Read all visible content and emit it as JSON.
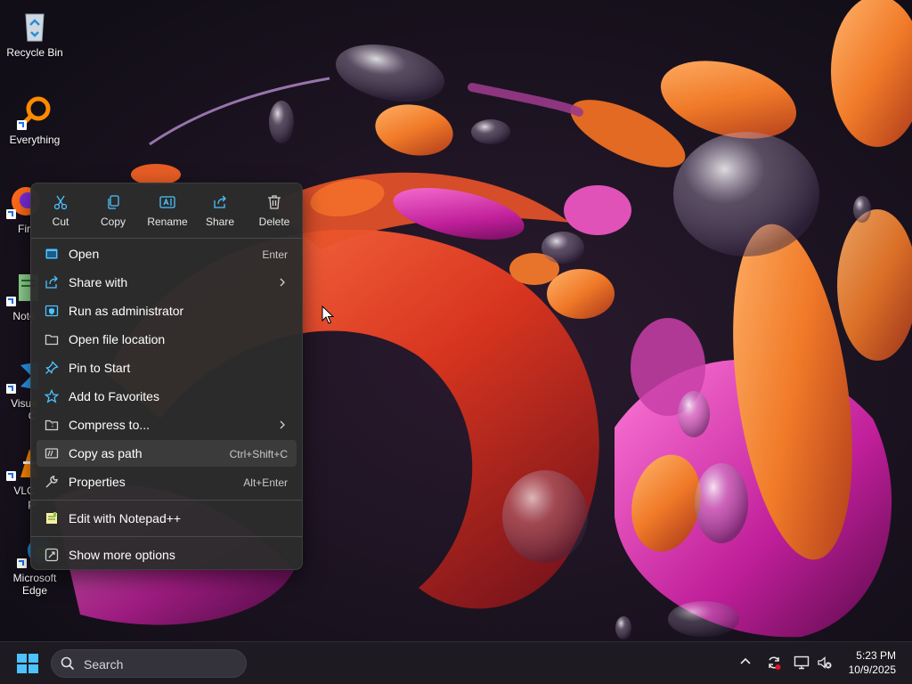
{
  "desktop": {
    "icons": [
      {
        "label": "Recycle Bin",
        "icon": "recycle-bin-icon"
      },
      {
        "label": "Everything",
        "icon": "everything-search-icon"
      },
      {
        "label": "Fir",
        "icon": "firefox-icon"
      },
      {
        "label": "Note",
        "icon": "notepad-icon"
      },
      {
        "label": "Visua",
        "icon": "vscode-icon",
        "label2": "C"
      },
      {
        "label": "VLC",
        "icon": "vlc-icon",
        "label2": "pl"
      },
      {
        "label": "Microsoft",
        "icon": "edge-icon",
        "label2": "Edge"
      }
    ]
  },
  "context_menu": {
    "quick_actions": [
      {
        "label": "Cut",
        "icon": "scissors-icon"
      },
      {
        "label": "Copy",
        "icon": "copy-icon"
      },
      {
        "label": "Rename",
        "icon": "rename-icon"
      },
      {
        "label": "Share",
        "icon": "share-icon"
      },
      {
        "label": "Delete",
        "icon": "trash-icon"
      }
    ],
    "items": [
      {
        "label": "Open",
        "accel": "Enter",
        "icon": "window-icon"
      },
      {
        "label": "Share with",
        "accel": "",
        "icon": "share-with-icon",
        "submenu": true
      },
      {
        "label": "Run as administrator",
        "accel": "",
        "icon": "admin-shield-icon"
      },
      {
        "label": "Open file location",
        "accel": "",
        "icon": "folder-icon"
      },
      {
        "label": "Pin to Start",
        "accel": "",
        "icon": "pin-icon"
      },
      {
        "label": "Add to Favorites",
        "accel": "",
        "icon": "star-icon"
      },
      {
        "label": "Compress to...",
        "accel": "",
        "icon": "archive-icon",
        "submenu": true
      },
      {
        "label": "Copy as path",
        "accel": "Ctrl+Shift+C",
        "icon": "path-icon",
        "highlighted": true
      },
      {
        "label": "Properties",
        "accel": "Alt+Enter",
        "icon": "wrench-icon"
      },
      {
        "label": "Edit with Notepad++",
        "accel": "",
        "icon": "notepadpp-icon"
      },
      {
        "label": "Show more options",
        "accel": "",
        "icon": "more-options-icon"
      }
    ]
  },
  "taskbar": {
    "search_placeholder": "Search",
    "time": "5:23 PM",
    "date": "10/9/2025"
  },
  "colors": {
    "menu_bg": "#2c2c2c",
    "taskbar_bg": "#1d1b21",
    "accent_blue": "#4cc2ff",
    "highlight": "#3b3b3b"
  }
}
